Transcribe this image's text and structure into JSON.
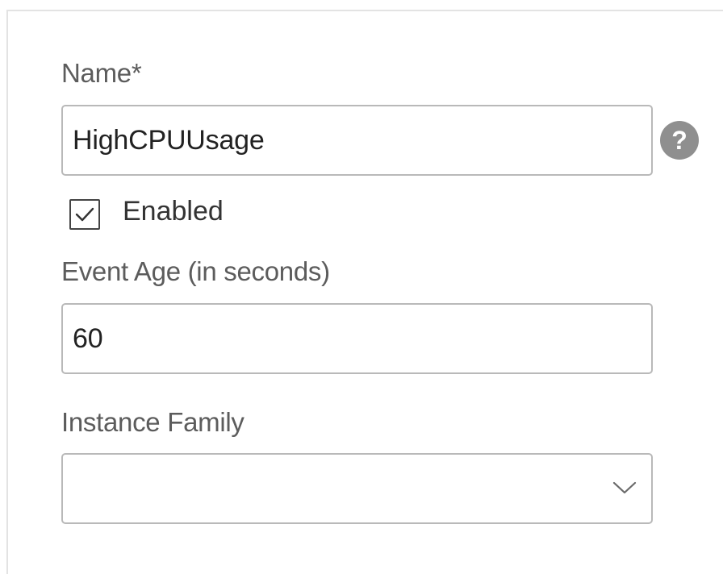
{
  "form": {
    "name": {
      "label": "Name*",
      "value": "HighCPUUsage",
      "help_icon": "question-circle-icon"
    },
    "enabled": {
      "label": "Enabled",
      "checked": true
    },
    "event_age": {
      "label": "Event Age (in seconds)",
      "value": "60"
    },
    "instance_family": {
      "label": "Instance Family",
      "value": "",
      "icon": "chevron-down-icon"
    }
  }
}
